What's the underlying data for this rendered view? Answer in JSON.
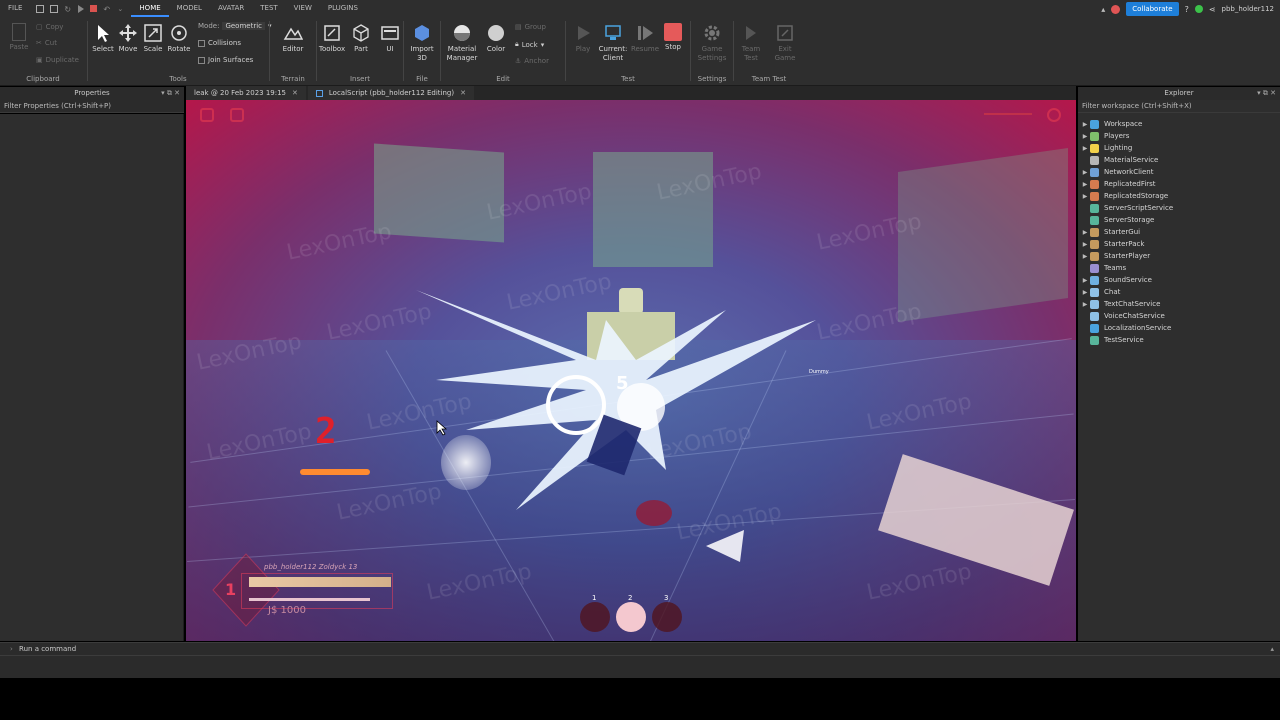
{
  "menubar": {
    "items": [
      "FILE",
      "HOME",
      "MODEL",
      "AVATAR",
      "TEST",
      "VIEW",
      "PLUGINS"
    ],
    "active": "HOME",
    "collaborate_label": "Collaborate",
    "username": "pbb_holder112"
  },
  "ribbon": {
    "clipboard": {
      "paste": "Paste",
      "copy": "Copy",
      "cut": "Cut",
      "duplicate": "Duplicate",
      "group_label": "Clipboard"
    },
    "tools": {
      "select": "Select",
      "move": "Move",
      "scale": "Scale",
      "rotate": "Rotate",
      "mode_label": "Mode:",
      "mode_value": "Geometric",
      "collisions": "Collisions",
      "join_surfaces": "Join Surfaces",
      "group_label": "Tools"
    },
    "terrain": {
      "editor": "Editor",
      "group_label": "Terrain"
    },
    "insert": {
      "toolbox": "Toolbox",
      "part": "Part",
      "ui": "UI",
      "group_label": "Insert"
    },
    "file": {
      "import3d": "Import 3D",
      "group_label": "File"
    },
    "edit": {
      "material_manager": "Material Manager",
      "color": "Color",
      "group": "Group",
      "lock": "Lock",
      "anchor": "Anchor",
      "group_label": "Edit"
    },
    "test": {
      "play": "Play",
      "current_client": "Current: Client",
      "resume": "Resume",
      "stop": "Stop",
      "group_label": "Test"
    },
    "settings": {
      "game_settings": "Game Settings",
      "group_label": "Settings"
    },
    "team_test": {
      "team_test": "Team Test",
      "exit_game": "Exit Game",
      "group_label": "Team Test"
    }
  },
  "properties": {
    "title": "Properties",
    "filter_placeholder": "Filter Properties (Ctrl+Shift+P)"
  },
  "tabs": [
    {
      "label": "leak @ 20 Feb 2023 19:15"
    },
    {
      "label": "LocalScript (pbb_holder112 Editing)"
    }
  ],
  "viewport": {
    "watermark": "LexOnTop",
    "npc_label": "Dummy",
    "combo_count": "2",
    "hit_counter": "5",
    "hud": {
      "name_line": "pbb_holder112 Zoldyck 13",
      "level": "1",
      "money": "J$ 1000",
      "hp_fraction": 1.0,
      "stamina_fraction": 0.85
    },
    "hotbar": [
      {
        "num": "1",
        "selected": false
      },
      {
        "num": "2",
        "selected": true
      },
      {
        "num": "3",
        "selected": false
      }
    ]
  },
  "explorer": {
    "title": "Explorer",
    "filter_placeholder": "Filter workspace (Ctrl+Shift+X)",
    "items": [
      {
        "label": "Workspace",
        "expandable": true,
        "color": "#4aa3df"
      },
      {
        "label": "Players",
        "expandable": true,
        "color": "#7fc16b"
      },
      {
        "label": "Lighting",
        "expandable": true,
        "color": "#f2d14a"
      },
      {
        "label": "MaterialService",
        "expandable": false,
        "color": "#b7b7b7"
      },
      {
        "label": "NetworkClient",
        "expandable": true,
        "color": "#6fa0d6"
      },
      {
        "label": "ReplicatedFirst",
        "expandable": true,
        "color": "#d67b4f"
      },
      {
        "label": "ReplicatedStorage",
        "expandable": true,
        "color": "#d67b4f"
      },
      {
        "label": "ServerScriptService",
        "expandable": false,
        "color": "#58b59b"
      },
      {
        "label": "ServerStorage",
        "expandable": false,
        "color": "#58b59b"
      },
      {
        "label": "StarterGui",
        "expandable": true,
        "color": "#c49a5e"
      },
      {
        "label": "StarterPack",
        "expandable": true,
        "color": "#c49a5e"
      },
      {
        "label": "StarterPlayer",
        "expandable": true,
        "color": "#c49a5e"
      },
      {
        "label": "Teams",
        "expandable": false,
        "color": "#9b8fd1"
      },
      {
        "label": "SoundService",
        "expandable": true,
        "color": "#6fb0e0"
      },
      {
        "label": "Chat",
        "expandable": true,
        "color": "#8fc1e6"
      },
      {
        "label": "TextChatService",
        "expandable": true,
        "color": "#8fc1e6"
      },
      {
        "label": "VoiceChatService",
        "expandable": false,
        "color": "#8fc1e6"
      },
      {
        "label": "LocalizationService",
        "expandable": false,
        "color": "#4aa3df"
      },
      {
        "label": "TestService",
        "expandable": false,
        "color": "#58b59b"
      }
    ]
  },
  "command_bar": {
    "placeholder": "Run a command"
  }
}
